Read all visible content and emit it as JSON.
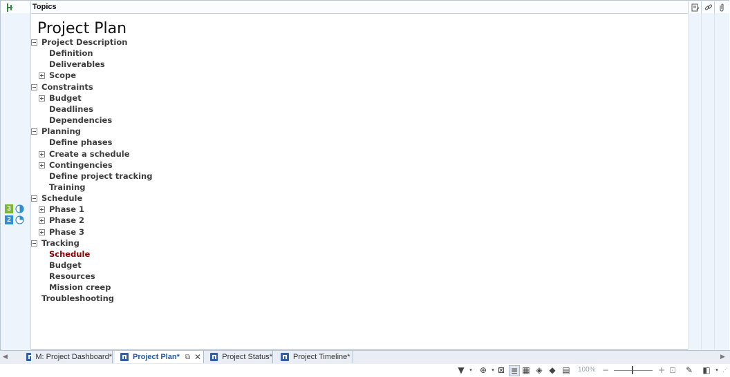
{
  "header": {
    "title": "Topics"
  },
  "outline": {
    "root": "Project Plan",
    "items": [
      {
        "label": "Project Description",
        "level": 1,
        "toggle": "minus"
      },
      {
        "label": "Definition",
        "level": 2,
        "toggle": "none"
      },
      {
        "label": "Deliverables",
        "level": 2,
        "toggle": "none"
      },
      {
        "label": "Scope",
        "level": 2,
        "toggle": "plus"
      },
      {
        "label": "Constraints",
        "level": 1,
        "toggle": "minus"
      },
      {
        "label": "Budget",
        "level": 2,
        "toggle": "plus"
      },
      {
        "label": "Deadlines",
        "level": 2,
        "toggle": "none"
      },
      {
        "label": "Dependencies",
        "level": 2,
        "toggle": "none"
      },
      {
        "label": "Planning",
        "level": 1,
        "toggle": "minus"
      },
      {
        "label": "Define phases",
        "level": 2,
        "toggle": "none"
      },
      {
        "label": "Create a schedule",
        "level": 2,
        "toggle": "plus"
      },
      {
        "label": "Contingencies",
        "level": 2,
        "toggle": "plus"
      },
      {
        "label": "Define project tracking",
        "level": 2,
        "toggle": "none"
      },
      {
        "label": "Training",
        "level": 2,
        "toggle": "none"
      },
      {
        "label": "Schedule",
        "level": 1,
        "toggle": "minus"
      },
      {
        "label": "Phase 1",
        "level": 2,
        "toggle": "plus",
        "priority": "3",
        "priority_color": "#7cb82f",
        "progress": 0.5
      },
      {
        "label": "Phase 2",
        "level": 2,
        "toggle": "plus",
        "priority": "2",
        "priority_color": "#2e8fd8",
        "progress": 0.25
      },
      {
        "label": "Phase 3",
        "level": 2,
        "toggle": "plus"
      },
      {
        "label": "Tracking",
        "level": 1,
        "toggle": "minus"
      },
      {
        "label": "Schedule",
        "level": 2,
        "toggle": "none",
        "selected": true
      },
      {
        "label": "Budget",
        "level": 2,
        "toggle": "none"
      },
      {
        "label": "Resources",
        "level": 2,
        "toggle": "none"
      },
      {
        "label": "Mission creep",
        "level": 2,
        "toggle": "none"
      },
      {
        "label": "Troubleshooting",
        "level": 1,
        "toggle": "none"
      }
    ]
  },
  "tabs": [
    {
      "label": "M: Project Dashboard*",
      "active": false
    },
    {
      "label": "Project Plan*",
      "active": true
    },
    {
      "label": "Project Status*",
      "active": false
    },
    {
      "label": "Project Timeline*",
      "active": false
    }
  ],
  "status": {
    "zoom": "100%"
  },
  "colors": {
    "selected_text": "#8b0000",
    "active_tab_text": "#1f5aa6"
  }
}
